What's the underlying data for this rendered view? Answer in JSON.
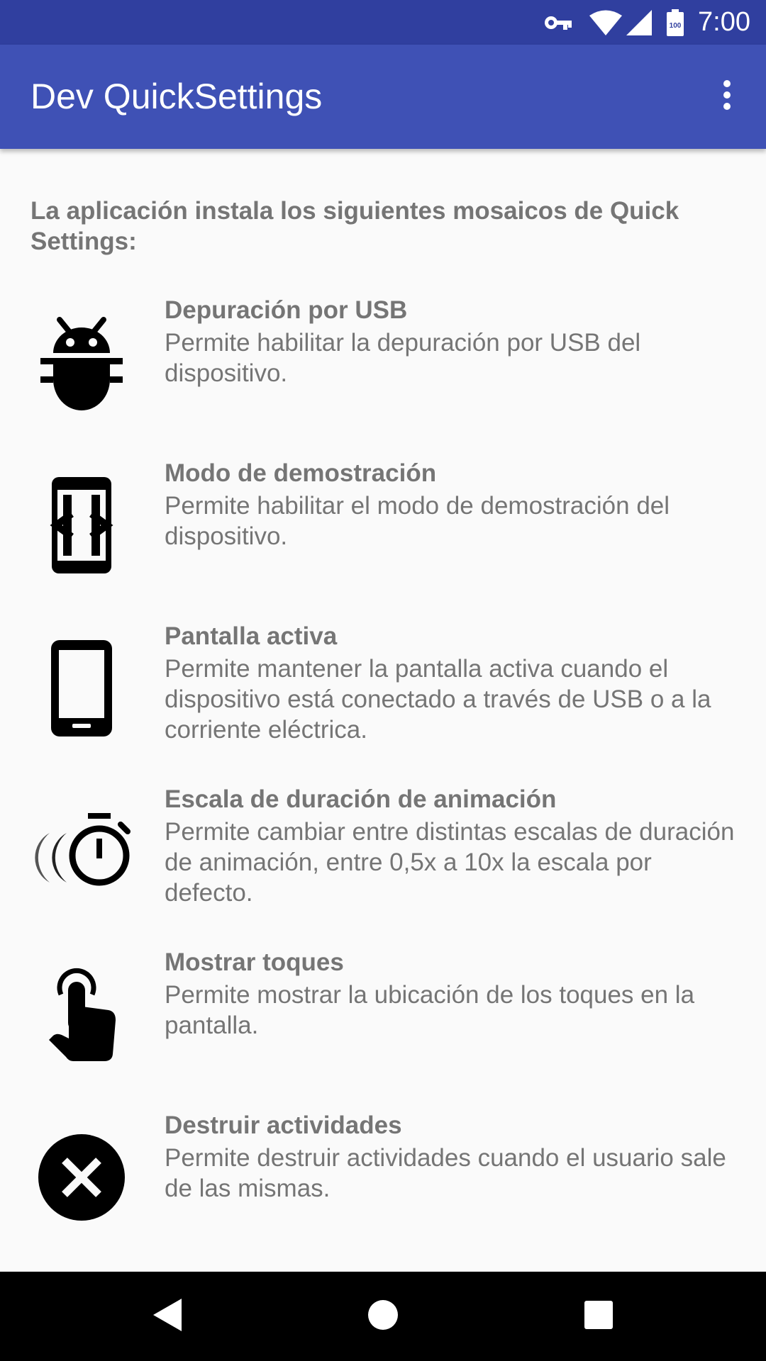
{
  "status_bar": {
    "time": "7:00",
    "battery_level": "100",
    "icons": [
      "vpn-key-icon",
      "wifi-icon",
      "cellular-signal-icon",
      "battery-icon"
    ]
  },
  "app_bar": {
    "title": "Dev QuickSettings",
    "menu_icon": "more-vert-icon"
  },
  "intro": "La aplicación instala los siguientes mosaicos de Quick Settings:",
  "tiles": [
    {
      "icon": "bug-icon",
      "title": "Depuración por USB",
      "description": "Permite habilitar la depuración por USB del dispositivo."
    },
    {
      "icon": "demo-mode-icon",
      "title": "Modo de demostración",
      "description": "Permite habilitar el modo de demostración del dispositivo."
    },
    {
      "icon": "phone-screen-icon",
      "title": "Pantalla activa",
      "description": "Permite mantener la pantalla activa cuando el dispositivo está conectado a través de USB o a la corriente eléctrica."
    },
    {
      "icon": "animation-timer-icon",
      "title": "Escala de duración de animación",
      "description": "Permite cambiar entre distintas escalas de duración de animación, entre 0,5x a 10x la escala por defecto."
    },
    {
      "icon": "touch-icon",
      "title": "Mostrar toques",
      "description": "Permite mostrar la ubicación de los toques en la pantalla."
    },
    {
      "icon": "close-circle-icon",
      "title": "Destruir actividades",
      "description": "Permite destruir actividades cuando el usuario sale de las mismas."
    }
  ],
  "nav_bar": {
    "icons": [
      "back-icon",
      "home-icon",
      "recents-icon"
    ]
  },
  "colors": {
    "status_bar": "#303f9f",
    "app_bar": "#3f51b5",
    "text": "#757575",
    "background": "#fafafa"
  }
}
